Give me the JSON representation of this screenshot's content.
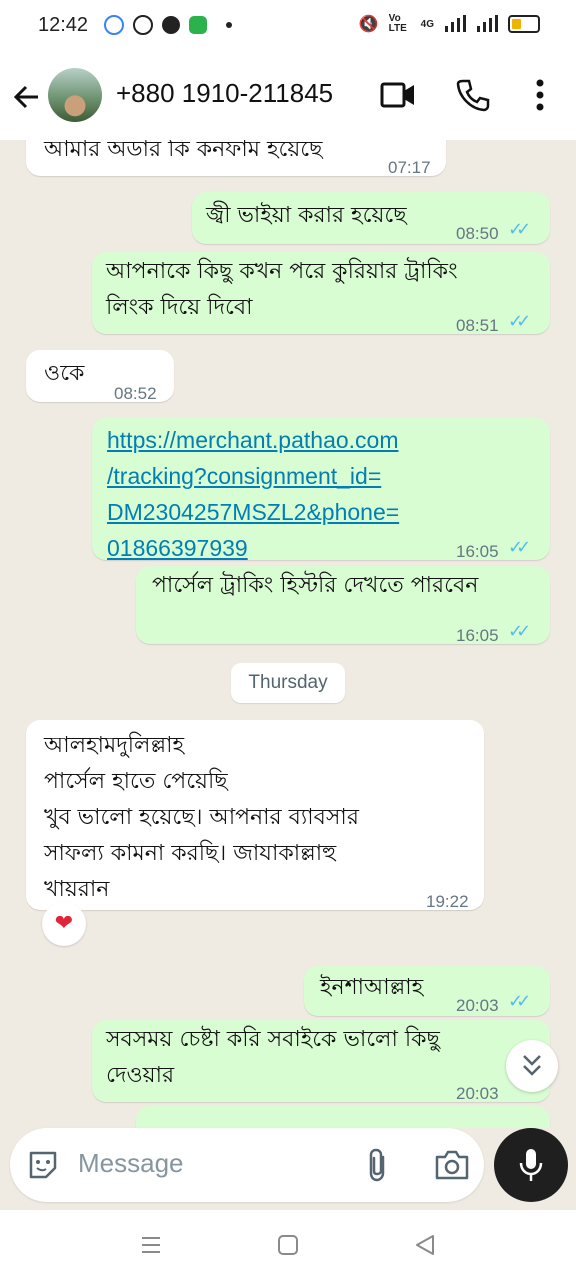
{
  "status_bar": {
    "time": "12:42",
    "network_label": "4G",
    "volte_label": "Vo LTE",
    "battery_color": "#f0b400"
  },
  "header": {
    "contact": "+880 1910-211845",
    "icons": [
      "back-arrow-icon",
      "video-call-icon",
      "phone-icon",
      "more-vertical-icon"
    ]
  },
  "messages": [
    {
      "dir": "in",
      "text": "আমার অডার কি কনফাম হয়েছে",
      "time": "07:17"
    },
    {
      "dir": "out",
      "text": "জ্বী ভাইয়া করার হয়েছে",
      "time": "08:50"
    },
    {
      "dir": "out",
      "text": "আপনাকে কিছু কখন পরে কুরিয়ার ট্রাকিং\nলিংক দিয়ে দিবো",
      "time": "08:51"
    },
    {
      "dir": "in",
      "text": "ওকে",
      "time": "08:52"
    },
    {
      "dir": "out",
      "text": "https://merchant.pathao.com\n/tracking?consignment_id=\nDM2304257MSZL2&phone=\n01866397939",
      "time": "16:05"
    },
    {
      "dir": "out",
      "text": "পার্সেল ট্রাকিং হিস্টরি দেখতে পারবেন",
      "time": "16:05"
    },
    {
      "dir": "in",
      "text": "আলহামদুলিল্লাহ\nপার্সেল হাতে পেয়েছি\nখুব ভালো হয়েছে। আপনার ব্যাবসার\nসাফল্য কামনা করছি। জাযাকাল্লাহু\nখায়রান",
      "time": "19:22",
      "reaction": "❤"
    },
    {
      "dir": "out",
      "text": "ইনশাআল্লাহ",
      "time": "20:03"
    },
    {
      "dir": "out",
      "text": "সবসময় চেষ্টা করি সবাইকে ভালো কিছু\nদেওয়ার",
      "time": "20:03"
    }
  ],
  "day_divider": "Thursday",
  "input": {
    "placeholder": "Message"
  },
  "colors": {
    "incoming": "#ffffff",
    "outgoing": "#d9fdd3",
    "read_ticks": "#53bdeb",
    "link": "#027eb5",
    "wallpaper": "#efeae2"
  }
}
